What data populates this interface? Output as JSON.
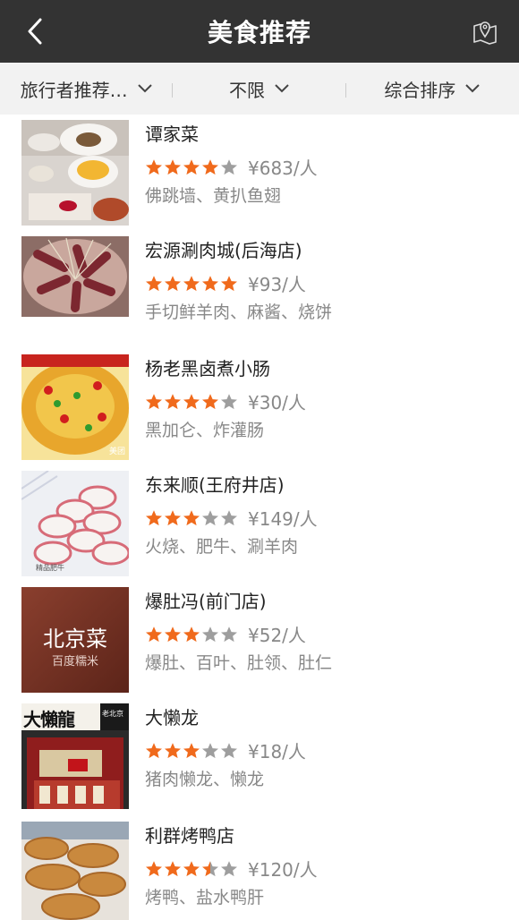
{
  "header": {
    "title": "美食推荐",
    "back_icon": "chevron-left-icon",
    "map_icon": "map-pin-icon"
  },
  "filters": [
    {
      "label": "旅行者推荐…",
      "icon": "chevron-down-icon"
    },
    {
      "label": "不限",
      "icon": "chevron-down-icon"
    },
    {
      "label": "综合排序",
      "icon": "chevron-down-icon"
    }
  ],
  "colors": {
    "header_bg": "#333333",
    "star_on": "#f06a1c",
    "star_off": "#9e9e9e",
    "filter_bg": "#f2f2f2"
  },
  "restaurants": [
    {
      "name": "谭家菜",
      "stars": 4,
      "price": "¥683/人",
      "tags": "佛跳墙、黄扒鱼翅"
    },
    {
      "name": "宏源涮肉城(后海店)",
      "stars": 5,
      "price": "¥93/人",
      "tags": "手切鲜羊肉、麻酱、烧饼"
    },
    {
      "name": "杨老黑卤煮小肠",
      "stars": 4,
      "price": "¥30/人",
      "tags": "黑加仑、炸灌肠",
      "image_text": "美团"
    },
    {
      "name": "东来顺(王府井店)",
      "stars": 3,
      "price": "¥149/人",
      "tags": "火烧、肥牛、涮羊肉",
      "image_text": "精品肥牛"
    },
    {
      "name": "爆肚冯(前门店)",
      "stars": 3,
      "price": "¥52/人",
      "tags": "爆肚、百叶、肚领、肚仁",
      "image_text": "北京菜",
      "image_subtext": "百度糯米"
    },
    {
      "name": "大懒龙",
      "stars": 3,
      "price": "¥18/人",
      "tags": "猪肉懒龙、懒龙",
      "image_text": "大懶龍",
      "image_subtext": "老北京"
    },
    {
      "name": "利群烤鸭店",
      "stars": 3.5,
      "price": "¥120/人",
      "tags": "烤鸭、盐水鸭肝"
    }
  ]
}
